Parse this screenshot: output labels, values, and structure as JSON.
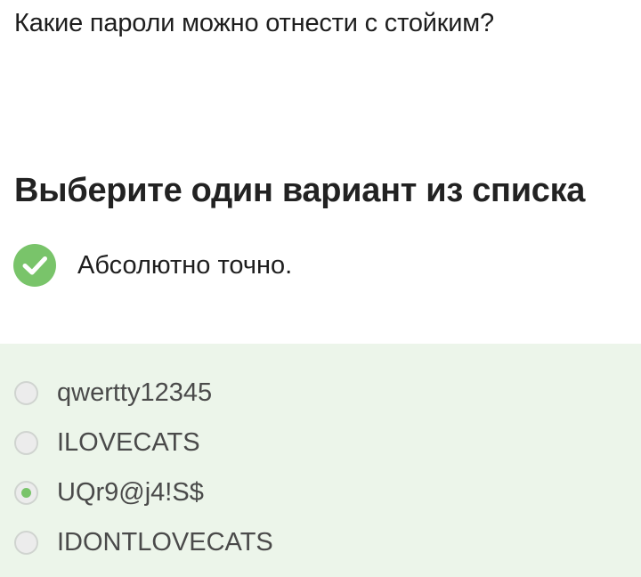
{
  "question": {
    "text": "Какие пароли можно отнести с стойким?"
  },
  "instruction": {
    "text": "Выберите один вариант из списка"
  },
  "result": {
    "icon": "check-circle-icon",
    "color": "#79c46a",
    "text": "Абсолютно точно."
  },
  "options_panel": {
    "background": "#ecf5ea",
    "options": [
      {
        "label": "qwertty12345",
        "selected": false
      },
      {
        "label": "ILOVECATS",
        "selected": false
      },
      {
        "label": "UQr9@j4!S$",
        "selected": true
      },
      {
        "label": "IDONTLOVECATS",
        "selected": false
      }
    ]
  }
}
